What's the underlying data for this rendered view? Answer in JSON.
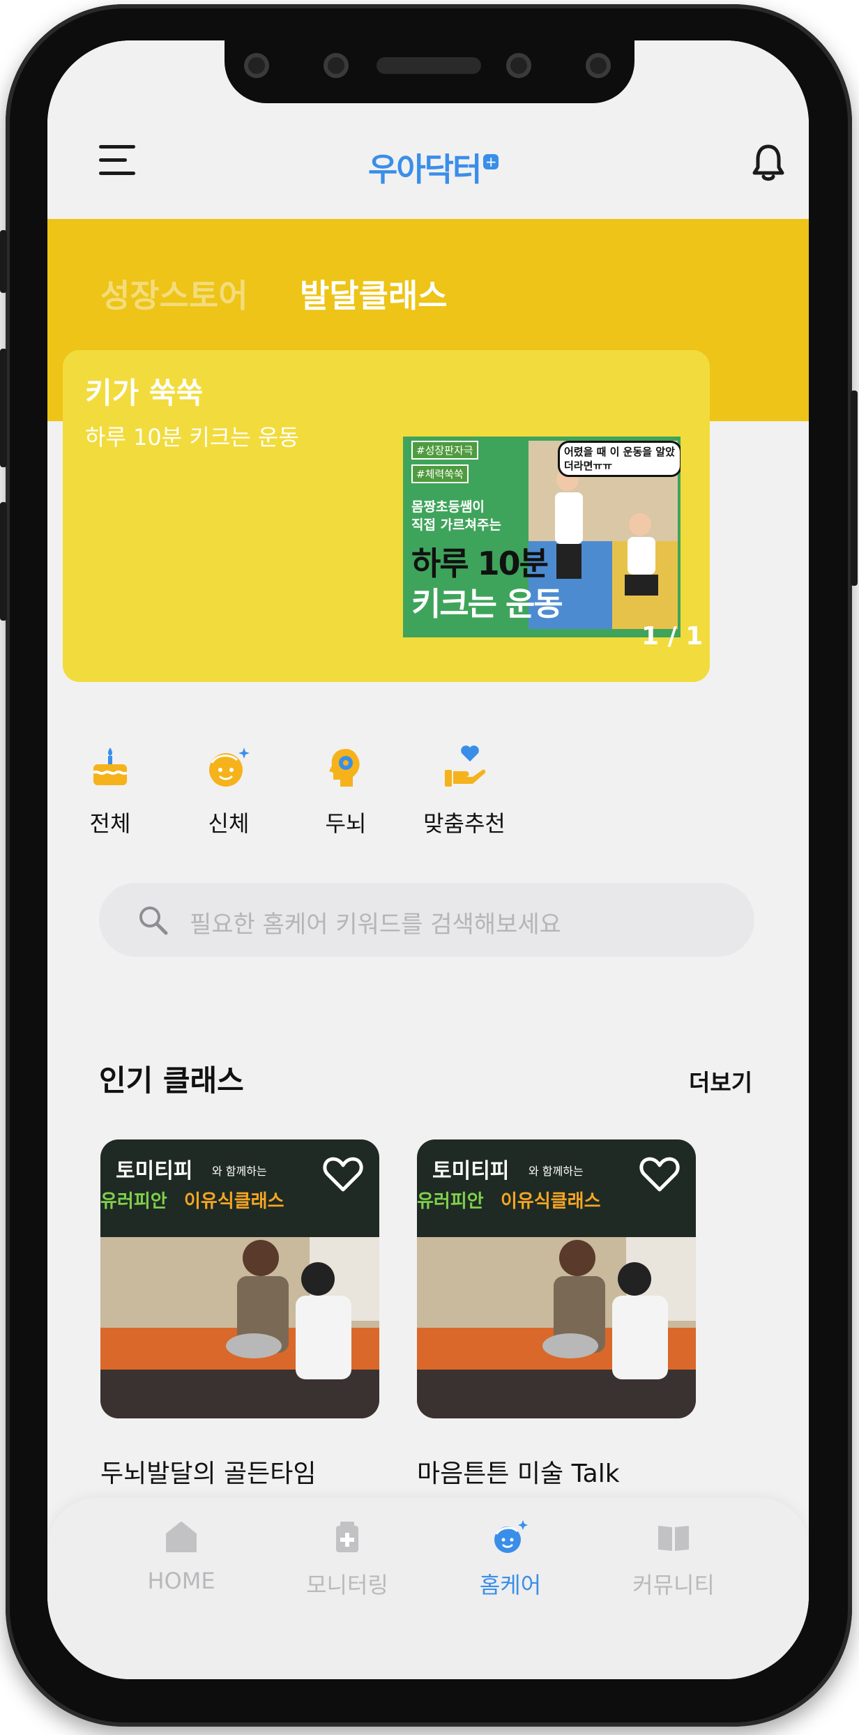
{
  "header": {
    "logo_text": "우아닥터",
    "logo_plus": "+"
  },
  "tabs": [
    {
      "label": "성장스토어",
      "active": false
    },
    {
      "label": "발달클래스",
      "active": true
    }
  ],
  "banner": {
    "title": "키가 쑥쑥",
    "subtitle": "하루 10분 키크는 운동",
    "page_indicator": "1 / 1",
    "thumb": {
      "tag1": "#성장판자극",
      "tag2": "#체력쑥쑥",
      "speech": "어렸을 때 이 운동을 알았더라면ㅠㅠ",
      "line1": "몸짱초등쌤이",
      "line2": "직접 가르쳐주는",
      "headline1": "하루 10분",
      "headline2": "키크는 운동"
    }
  },
  "categories": [
    {
      "label": "전체",
      "icon": "cake-icon"
    },
    {
      "label": "신체",
      "icon": "face-sparkle-icon"
    },
    {
      "label": "두뇌",
      "icon": "head-gear-icon"
    },
    {
      "label": "맞춤추천",
      "icon": "hand-heart-icon"
    }
  ],
  "search": {
    "placeholder": "필요한 홈케어 키워드를 검색해보세요"
  },
  "popular": {
    "title": "인기 클래스",
    "more": "더보기",
    "items": [
      {
        "title": "두뇌발달의 골든타임",
        "sign_line1": "토미티피",
        "sign_small": "와 함께하는",
        "sign_line2a": "유러피안",
        "sign_line2b": "이유식클래스"
      },
      {
        "title": "마음튼튼 미술 Talk",
        "sign_line1": "토미티피",
        "sign_small": "와 함께하는",
        "sign_line2a": "유러피안",
        "sign_line2b": "이유식클래스"
      }
    ]
  },
  "bottom_nav": [
    {
      "label": "HOME",
      "icon": "home-icon",
      "active": false
    },
    {
      "label": "모니터링",
      "icon": "clipboard-plus-icon",
      "active": false
    },
    {
      "label": "홈케어",
      "icon": "face-sparkle-icon",
      "active": true
    },
    {
      "label": "커뮤니티",
      "icon": "book-open-icon",
      "active": false
    }
  ],
  "colors": {
    "brand_yellow": "#edc417",
    "banner_yellow": "#f2db3c",
    "accent_blue": "#3a8ee8",
    "icon_orange": "#f5b21b"
  }
}
